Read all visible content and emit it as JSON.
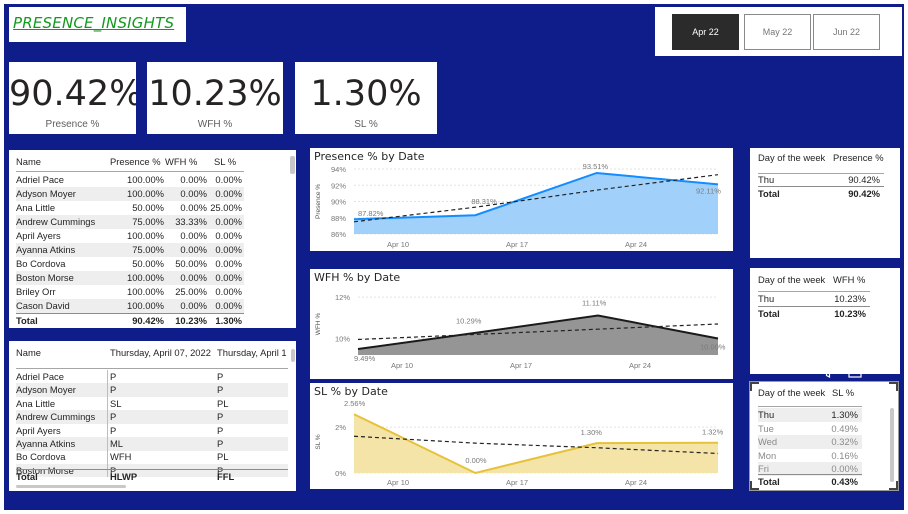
{
  "report_title": "PRESENCE_INSIGHTS",
  "month_slicer": {
    "options": [
      "Apr 22",
      "May 22",
      "Jun 22"
    ],
    "selected": "Apr 22"
  },
  "kpis": [
    {
      "value": "90.42%",
      "label": "Presence %"
    },
    {
      "value": "10.23%",
      "label": "WFH %"
    },
    {
      "value": "1.30%",
      "label": "SL %"
    }
  ],
  "person_table": {
    "columns": [
      "Name",
      "Presence %",
      "WFH %",
      "SL %"
    ],
    "rows": [
      [
        "Adriel Pace",
        "100.00%",
        "0.00%",
        "0.00%"
      ],
      [
        "Adyson Moyer",
        "100.00%",
        "0.00%",
        "0.00%"
      ],
      [
        "Ana Little",
        "50.00%",
        "0.00%",
        "25.00%"
      ],
      [
        "Andrew Cummings",
        "75.00%",
        "33.33%",
        "0.00%"
      ],
      [
        "April Ayers",
        "100.00%",
        "0.00%",
        "0.00%"
      ],
      [
        "Ayanna Atkins",
        "75.00%",
        "0.00%",
        "0.00%"
      ],
      [
        "Bo Cordova",
        "50.00%",
        "50.00%",
        "0.00%"
      ],
      [
        "Boston Morse",
        "100.00%",
        "0.00%",
        "0.00%"
      ],
      [
        "Briley Orr",
        "100.00%",
        "25.00%",
        "0.00%"
      ],
      [
        "Cason David",
        "100.00%",
        "0.00%",
        "0.00%"
      ]
    ],
    "total": [
      "Total",
      "90.42%",
      "10.23%",
      "1.30%"
    ]
  },
  "status_matrix": {
    "columns": [
      "Name",
      "Thursday, April 07, 2022",
      "Thursday, April 1"
    ],
    "rows": [
      [
        "Adriel Pace",
        "P",
        "P"
      ],
      [
        "Adyson Moyer",
        "P",
        "P"
      ],
      [
        "Ana Little",
        "SL",
        "PL"
      ],
      [
        "Andrew Cummings",
        "P",
        "P"
      ],
      [
        "April Ayers",
        "P",
        "P"
      ],
      [
        "Ayanna Atkins",
        "ML",
        "P"
      ],
      [
        "Bo Cordova",
        "WFH",
        "PL"
      ],
      [
        "Boston Morse",
        "P",
        "P"
      ]
    ],
    "total": [
      "Total",
      "HLWP",
      "FFL"
    ]
  },
  "dow_presence": {
    "columns": [
      "Day of the week",
      "Presence %"
    ],
    "rows": [
      [
        "Thu",
        "90.42%"
      ]
    ],
    "total": [
      "Total",
      "90.42%"
    ]
  },
  "dow_wfh": {
    "columns": [
      "Day of the week",
      "WFH %"
    ],
    "rows": [
      [
        "Thu",
        "10.23%"
      ]
    ],
    "total": [
      "Total",
      "10.23%"
    ]
  },
  "dow_sl": {
    "columns": [
      "Day of the week",
      "SL %"
    ],
    "rows": [
      [
        "Thu",
        "1.30%"
      ],
      [
        "Tue",
        "0.49%"
      ],
      [
        "Wed",
        "0.32%"
      ],
      [
        "Mon",
        "0.16%"
      ],
      [
        "Fri",
        "0.00%"
      ]
    ],
    "total": [
      "Total",
      "0.43%"
    ]
  },
  "icons": {
    "filter": "filter-icon",
    "focus": "focus-mode-icon",
    "more": "more-options-icon"
  },
  "colors": {
    "canvas": "#0f1d8a",
    "presence": "#118dff",
    "wfh": "#1a1a1a",
    "sl": "#e6c23a",
    "title": "#129a1f"
  },
  "chart_data": [
    {
      "type": "area",
      "title": "Presence % by Date",
      "ylabel": "Presence %",
      "x": [
        "2022-04-07",
        "2022-04-14",
        "2022-04-21",
        "2022-04-28"
      ],
      "xticks": [
        "Apr 10",
        "Apr 17",
        "Apr 24"
      ],
      "yticks": [
        "86%",
        "88%",
        "90%",
        "92%",
        "94%"
      ],
      "ylim": [
        86,
        94
      ],
      "values": [
        87.82,
        88.31,
        93.51,
        92.11
      ],
      "data_labels": [
        "87.82%",
        "88.31%",
        "93.51%",
        "92.11%"
      ],
      "trend": [
        87.5,
        89.3,
        91.4,
        93.3
      ],
      "trendline": true,
      "grid": true
    },
    {
      "type": "area",
      "title": "WFH % by Date",
      "ylabel": "WFH %",
      "x": [
        "2022-04-07",
        "2022-04-14",
        "2022-04-21",
        "2022-04-28"
      ],
      "xticks": [
        "Apr 10",
        "Apr 17",
        "Apr 24"
      ],
      "yticks": [
        "10%",
        "12%"
      ],
      "ylim": [
        9.2,
        12.2
      ],
      "values": [
        9.49,
        10.29,
        11.11,
        10.0
      ],
      "data_labels": [
        "9.49%",
        "10.29%",
        "11.11%",
        "10.00%"
      ],
      "trend": [
        9.95,
        10.2,
        10.45,
        10.7
      ],
      "trendline": true,
      "grid": true
    },
    {
      "type": "area",
      "title": "SL % by Date",
      "ylabel": "SL %",
      "x": [
        "2022-04-07",
        "2022-04-14",
        "2022-04-21",
        "2022-04-28"
      ],
      "xticks": [
        "Apr 10",
        "Apr 17",
        "Apr 24"
      ],
      "yticks": [
        "0%",
        "2%"
      ],
      "ylim": [
        0,
        2.7
      ],
      "values": [
        2.56,
        0.0,
        1.3,
        1.32
      ],
      "data_labels": [
        "2.56%",
        "0.00%",
        "1.30%",
        "1.32%"
      ],
      "trend": [
        1.6,
        1.3,
        1.1,
        0.85
      ],
      "trendline": true,
      "grid": true
    }
  ]
}
